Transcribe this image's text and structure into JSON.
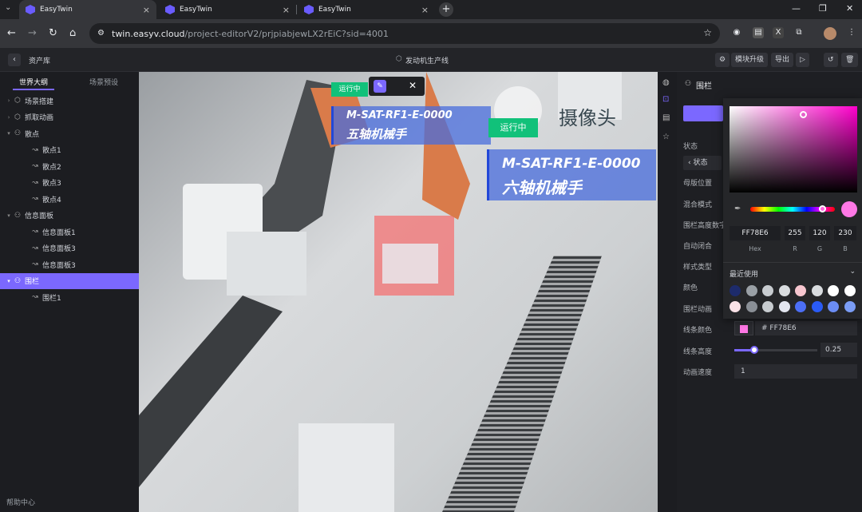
{
  "browser": {
    "tabs": [
      {
        "title": "EasyTwin",
        "close": "×"
      },
      {
        "title": "EasyTwin",
        "close": "×"
      },
      {
        "title": "EasyTwin",
        "close": "×"
      }
    ],
    "new_tab": "+",
    "url_domain": "twin.easyv.cloud",
    "url_path": "/project-editorV2/prjpiabjewLX2rEiC?sid=4001"
  },
  "header": {
    "asset_library": "资产库",
    "project_title": "发动机生产线",
    "upgrade": "模块升级",
    "export": "导出"
  },
  "outline": {
    "tab_outline": "世界大纲",
    "tab_scenes": "场景预设",
    "items": [
      {
        "label": "场景搭建",
        "icon": "cube-icon",
        "level": 0
      },
      {
        "label": "抓取动画",
        "icon": "cube-icon",
        "level": 0
      },
      {
        "label": "散点",
        "icon": "group-icon",
        "level": 0
      },
      {
        "label": "散点1",
        "icon": "link-icon",
        "level": 1
      },
      {
        "label": "散点2",
        "icon": "link-icon",
        "level": 1
      },
      {
        "label": "散点3",
        "icon": "link-icon",
        "level": 1
      },
      {
        "label": "散点4",
        "icon": "link-icon",
        "level": 1
      },
      {
        "label": "信息面板",
        "icon": "group-icon",
        "level": 0
      },
      {
        "label": "信息面板1",
        "icon": "link-icon",
        "level": 1
      },
      {
        "label": "信息面板3",
        "icon": "link-icon",
        "level": 1
      },
      {
        "label": "信息面板3",
        "icon": "link-icon",
        "level": 1
      },
      {
        "label": "围栏",
        "icon": "group-icon",
        "level": 0,
        "selected": true
      },
      {
        "label": "围栏1",
        "icon": "link-icon",
        "level": 1
      }
    ],
    "help": "帮助中心"
  },
  "viewport": {
    "badge_running_a": "运行中",
    "badge_running_b": "运行中",
    "label_a_code": "M-SAT-RF1-E-0000",
    "label_a_name": "五轴机械手",
    "label_b_code": "M-SAT-RF1-E-0000",
    "label_b_name": "六轴机械手",
    "camera_label": "摄像头"
  },
  "properties": {
    "title": "围栏",
    "rows": [
      "状态",
      "母版位置",
      "混合模式",
      "围栏高度数字",
      "自动闭合",
      "样式类型",
      "颜色",
      "围栏动画",
      "线条颜色",
      "线条高度",
      "动画速度"
    ],
    "state_sub": "状态",
    "line_color_value": "# FF78E6",
    "line_height_value": "0.25",
    "line_height_fraction": 0.25,
    "anim_speed_value": "1"
  },
  "color_picker": {
    "hex": "FF78E6",
    "r": "255",
    "g": "120",
    "b": "230",
    "hex_label": "Hex",
    "r_label": "R",
    "g_label": "G",
    "b_label": "B",
    "recent_title": "最近使用",
    "recent_colors": [
      "#1d2b6b",
      "#9aa0a6",
      "#c8ccd0",
      "#d9dcdf",
      "#f7c6cf",
      "#d9dcdf",
      "#ffffff",
      "#ffffff",
      "#fbe3e8",
      "#8a8f96",
      "#c8ccd0",
      "#e3e6f0",
      "#4c6ef5",
      "#2a5bf5",
      "#6b8df5",
      "#7a9cf5"
    ]
  },
  "colors": {
    "accent": "#7b68ff",
    "running_green": "#11c17a",
    "label_blue": "#486cdc",
    "swatch_pink": "#ff78e6"
  }
}
